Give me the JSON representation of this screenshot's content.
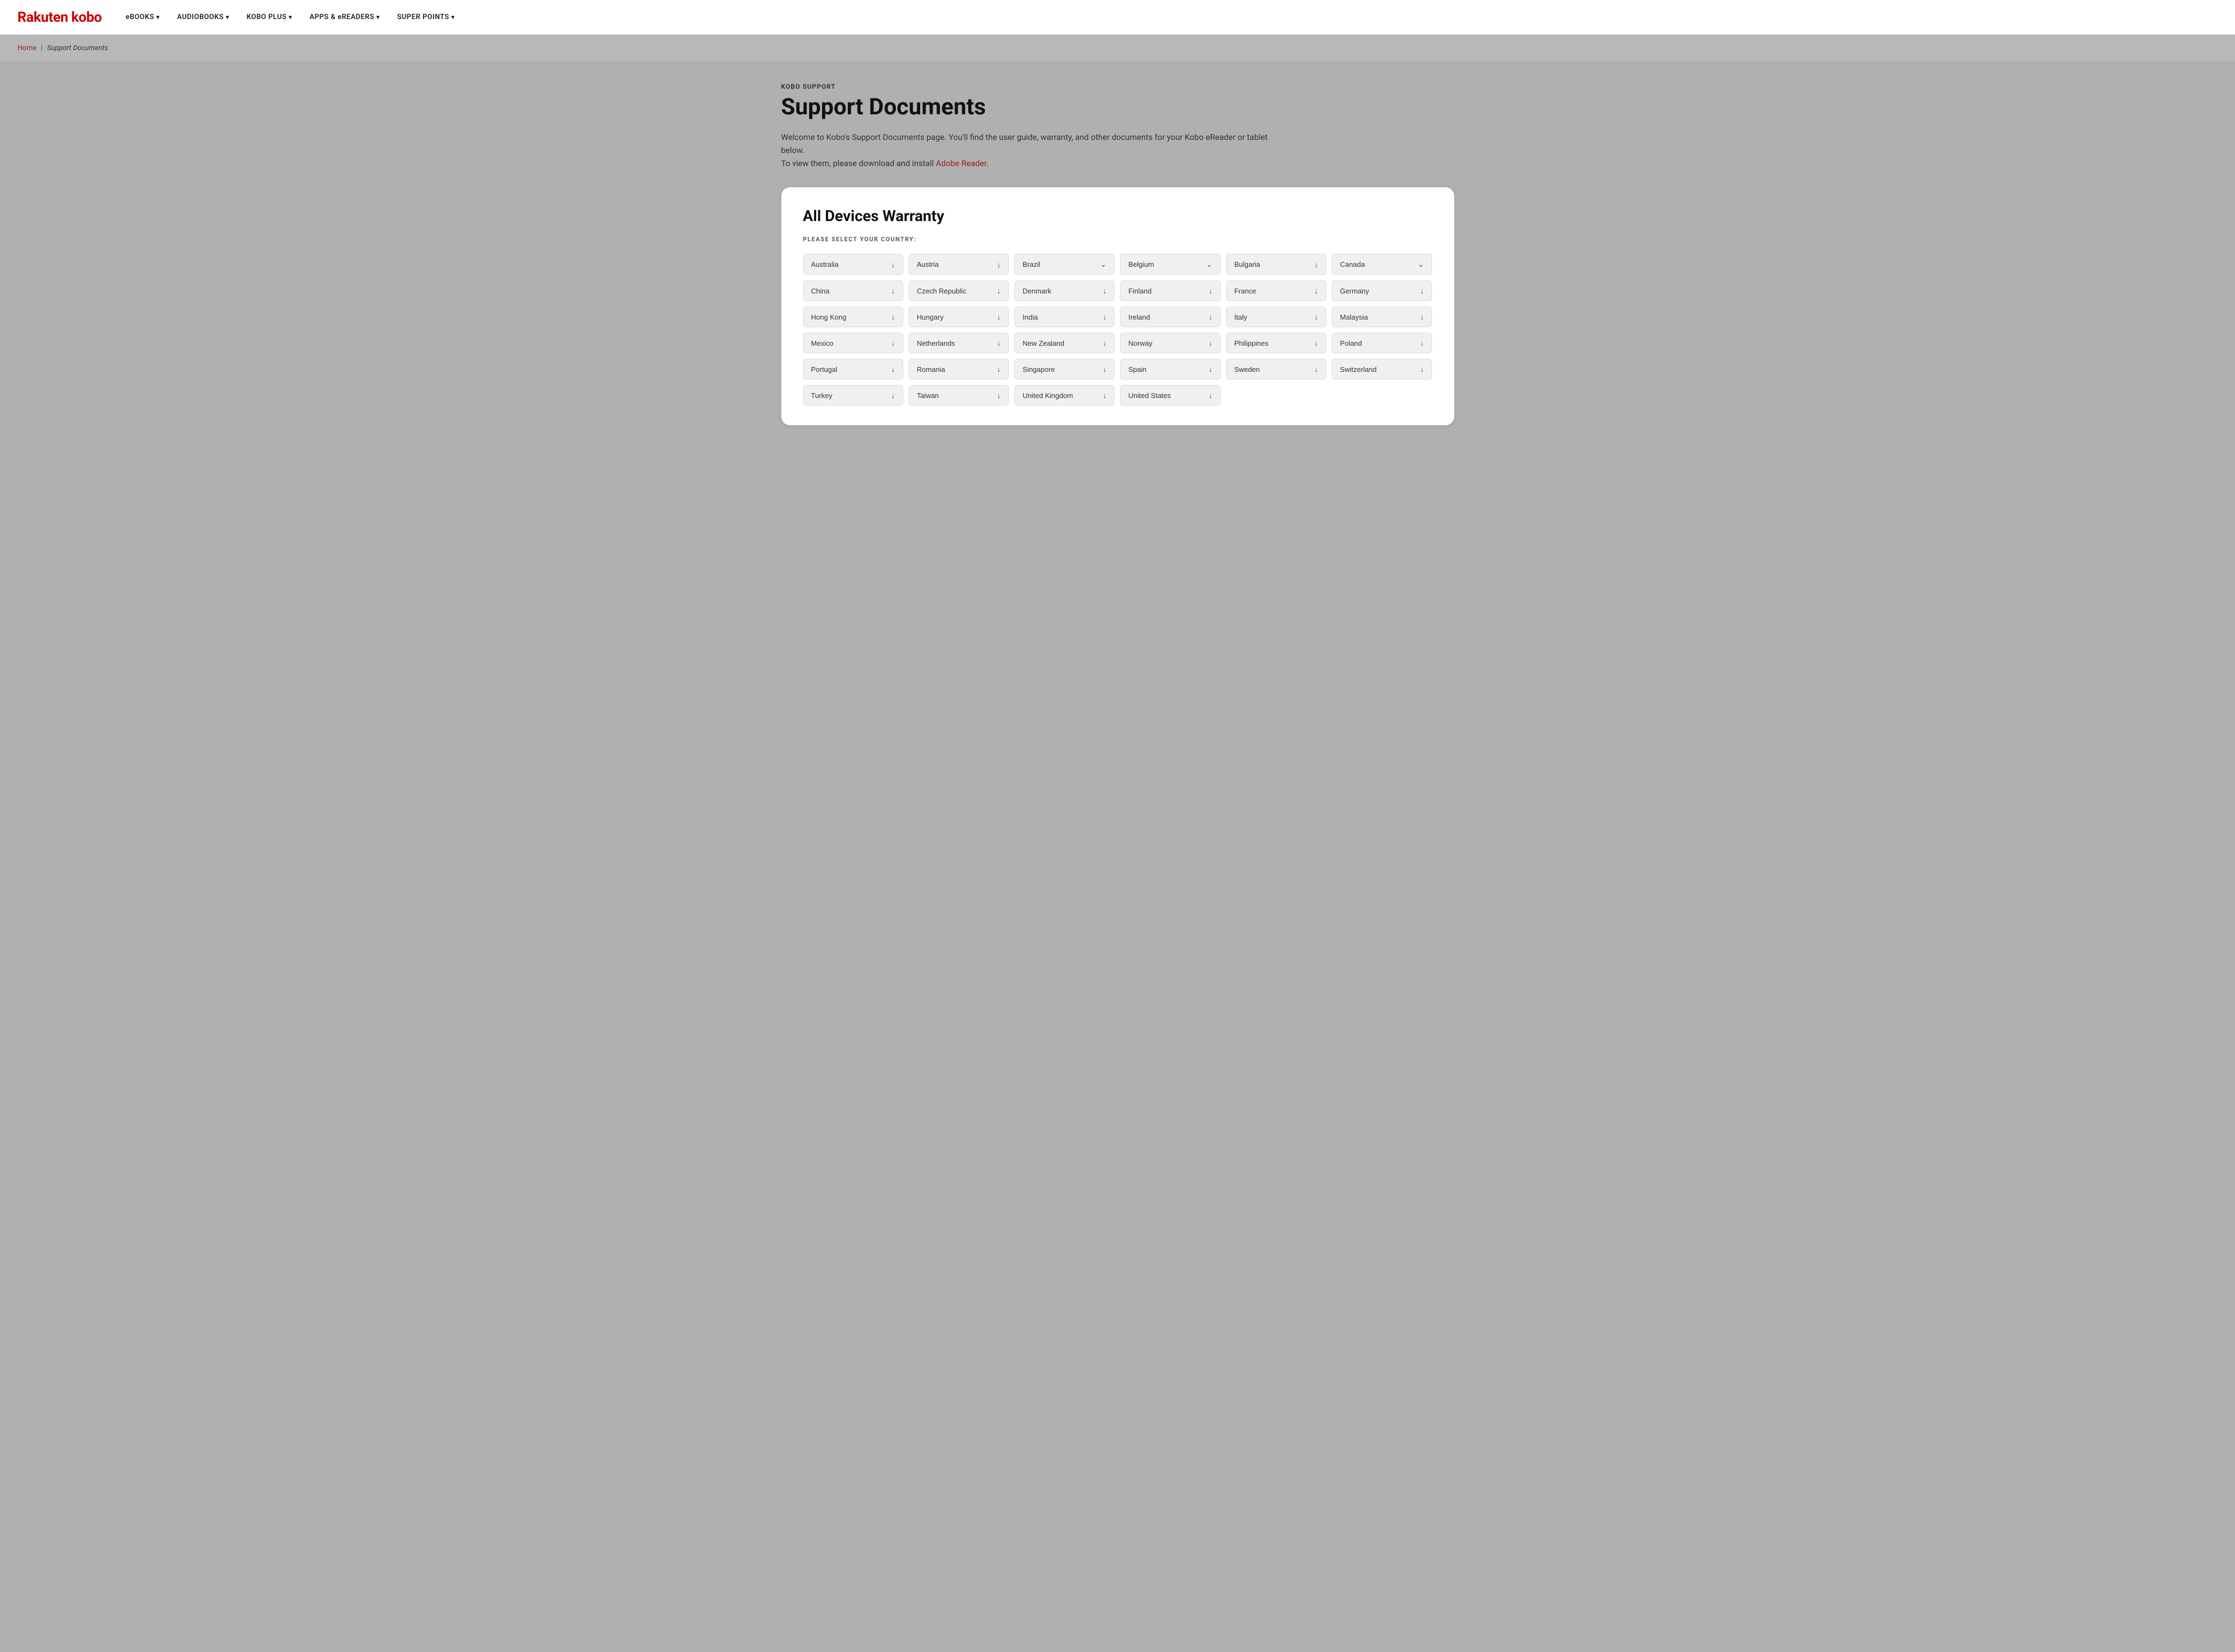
{
  "header": {
    "logo": "Rakuten kobo",
    "nav_items": [
      {
        "label": "eBOOKS",
        "has_dropdown": true
      },
      {
        "label": "AUDIOBOOKS",
        "has_dropdown": true
      },
      {
        "label": "KOBO PLUS",
        "has_dropdown": true
      },
      {
        "label": "APPS & eREADERS",
        "has_dropdown": true
      },
      {
        "label": "SUPER POINTS",
        "has_dropdown": true
      }
    ]
  },
  "breadcrumb": {
    "home_label": "Home",
    "separator": "|",
    "current_label": "Support Documents"
  },
  "page": {
    "section_label": "KOBO SUPPORT",
    "title": "Support Documents",
    "description_part1": "Welcome to Kobo's Support Documents page. You'll find the user guide, warranty, and other documents for your Kobo eReader or tablet below.",
    "description_part2": "To view them, please download and install ",
    "adobe_link_text": "Adobe Reader.",
    "adobe_link_url": "#"
  },
  "warranty_section": {
    "title": "All Devices Warranty",
    "select_label": "PLEASE SELECT YOUR COUNTRY:",
    "countries": [
      {
        "name": "Australia",
        "icon_type": "download"
      },
      {
        "name": "Austria",
        "icon_type": "download"
      },
      {
        "name": "Brazil",
        "icon_type": "chevron"
      },
      {
        "name": "Belgium",
        "icon_type": "chevron"
      },
      {
        "name": "Bulgaria",
        "icon_type": "download"
      },
      {
        "name": "Canada",
        "icon_type": "chevron"
      },
      {
        "name": "China",
        "icon_type": "download"
      },
      {
        "name": "Czech Republic",
        "icon_type": "download"
      },
      {
        "name": "Denmark",
        "icon_type": "download"
      },
      {
        "name": "Finland",
        "icon_type": "download"
      },
      {
        "name": "France",
        "icon_type": "download"
      },
      {
        "name": "Germany",
        "icon_type": "download"
      },
      {
        "name": "Hong Kong",
        "icon_type": "download"
      },
      {
        "name": "Hungary",
        "icon_type": "download"
      },
      {
        "name": "India",
        "icon_type": "download"
      },
      {
        "name": "Ireland",
        "icon_type": "download"
      },
      {
        "name": "Italy",
        "icon_type": "download"
      },
      {
        "name": "Malaysia",
        "icon_type": "download"
      },
      {
        "name": "Mexico",
        "icon_type": "download"
      },
      {
        "name": "Netherlands",
        "icon_type": "download"
      },
      {
        "name": "New Zealand",
        "icon_type": "download"
      },
      {
        "name": "Norway",
        "icon_type": "download"
      },
      {
        "name": "Philippines",
        "icon_type": "download"
      },
      {
        "name": "Poland",
        "icon_type": "download"
      },
      {
        "name": "Portugal",
        "icon_type": "download"
      },
      {
        "name": "Romania",
        "icon_type": "download"
      },
      {
        "name": "Singapore",
        "icon_type": "download"
      },
      {
        "name": "Spain",
        "icon_type": "download"
      },
      {
        "name": "Sweden",
        "icon_type": "download"
      },
      {
        "name": "Switzerland",
        "icon_type": "download"
      },
      {
        "name": "Turkey",
        "icon_type": "download"
      },
      {
        "name": "Taiwan",
        "icon_type": "download"
      },
      {
        "name": "United Kingdom",
        "icon_type": "download"
      },
      {
        "name": "United States",
        "icon_type": "download"
      }
    ]
  },
  "icons": {
    "download": "↓",
    "chevron": "⌄"
  }
}
